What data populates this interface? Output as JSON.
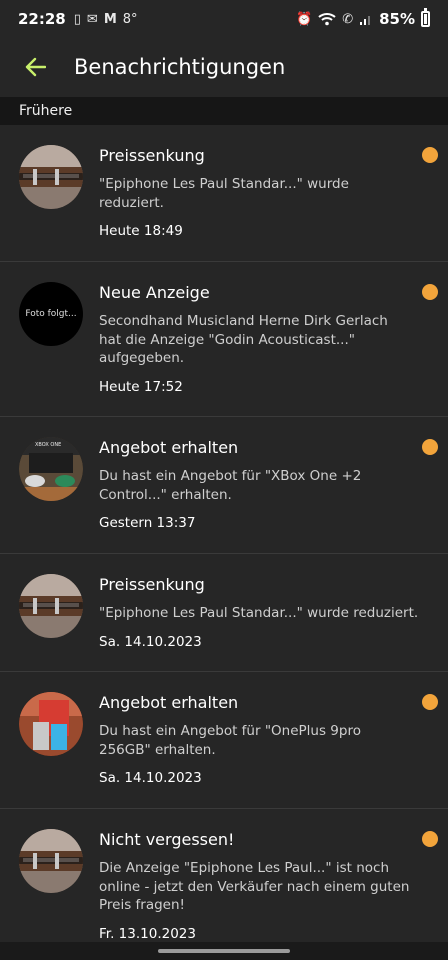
{
  "status": {
    "time": "22:28",
    "icons": [
      "tablet-icon",
      "mail-icon",
      "gmail-icon"
    ],
    "temp": "8°",
    "battery": "85%"
  },
  "header": {
    "title": "Benachrichtigungen",
    "back_icon": "back-arrow-icon"
  },
  "colors": {
    "accent": "#c8ef6b",
    "dot": "#f2a43b",
    "background": "#262626"
  },
  "section": {
    "label": "Frühere"
  },
  "items": [
    {
      "title": "Preissenkung",
      "text": "\"Epiphone Les Paul Standar...\" wurde reduziert.",
      "time": "Heute 18:49",
      "unread": true,
      "image": "guitar"
    },
    {
      "title": "Neue Anzeige",
      "text": "Secondhand Musicland Herne Dirk Gerlach hat die Anzeige \"Godin Acousticast...\" aufgegeben.",
      "time": "Heute 17:52",
      "unread": true,
      "image_text": "Foto folgt..."
    },
    {
      "title": "Angebot erhalten",
      "text": "Du hast ein Angebot für \"XBox One +2 Control...\" erhalten.",
      "time": "Gestern 13:37",
      "unread": true,
      "image": "xbox",
      "image_text": "XBOX ONE"
    },
    {
      "title": "Preissenkung",
      "text": "\"Epiphone Les Paul Standar...\" wurde reduziert.",
      "time": "Sa. 14.10.2023",
      "unread": false,
      "image": "guitar"
    },
    {
      "title": "Angebot erhalten",
      "text": "Du hast ein Angebot für \"OnePlus 9pro 256GB\" erhalten.",
      "time": "Sa. 14.10.2023",
      "unread": true,
      "image": "phone"
    },
    {
      "title": "Nicht vergessen!",
      "text": "Die Anzeige \"Epiphone Les Paul...\" ist noch online - jetzt den Verkäufer nach einem guten Preis fragen!",
      "time": "Fr. 13.10.2023",
      "unread": true,
      "image": "guitar"
    }
  ]
}
